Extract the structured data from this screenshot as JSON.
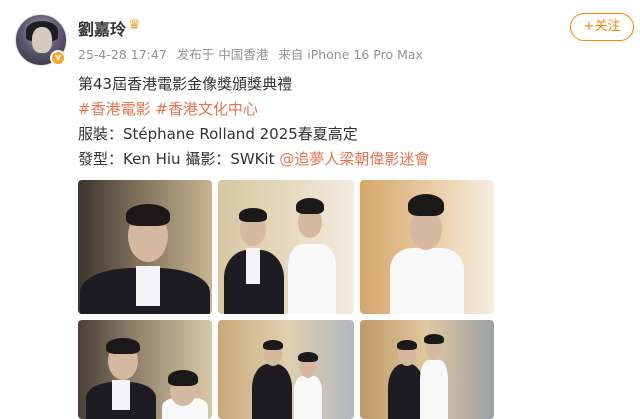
{
  "user": {
    "name": "劉嘉玲",
    "verified_badge": "v"
  },
  "meta": {
    "date": "25-4-28 17:47",
    "published_from": "发布于 中国香港",
    "device": "来自 iPhone 16 Pro Max"
  },
  "follow_label": "+关注",
  "post": {
    "line1": "第43屆香港電影金像獎頒獎典禮",
    "tag1": "#香港電影",
    "tag2": "#香港文化中心",
    "line3": "服裝：Stéphane Rolland 2025春夏高定",
    "line4_prefix": "發型：Ken Hiu 攝影：SWKit",
    "mention": "@追夢人梁朝偉影迷會"
  },
  "colors": {
    "accent": "#ff8200",
    "link": "#eb7350",
    "meta_text": "#939393"
  }
}
